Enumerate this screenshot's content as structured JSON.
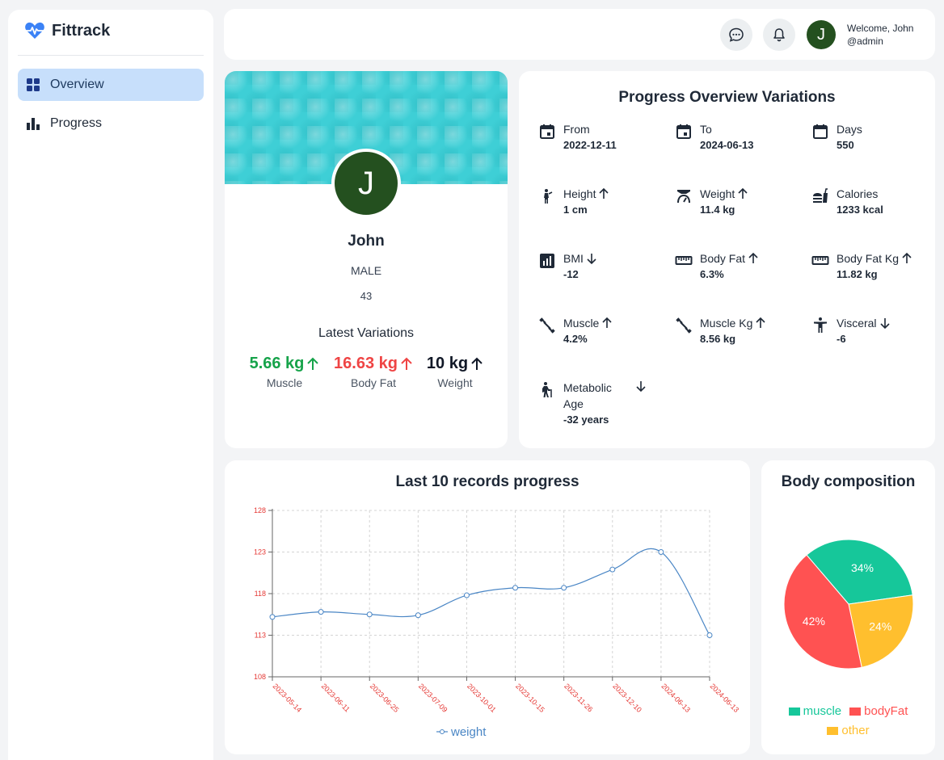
{
  "brand": {
    "name": "Fittrack",
    "accent": "#3b82f6"
  },
  "sidebar": {
    "items": [
      {
        "label": "Overview",
        "icon": "dashboard-icon",
        "active": true
      },
      {
        "label": "Progress",
        "icon": "bar-chart-icon",
        "active": false
      }
    ]
  },
  "header": {
    "avatar_initial": "J",
    "welcome": "Welcome, John",
    "handle": "@admin"
  },
  "profile": {
    "initial": "J",
    "name": "John",
    "gender": "MALE",
    "age": "43",
    "latest_title": "Latest Variations",
    "variations": [
      {
        "value": "5.66 kg",
        "label": "Muscle",
        "color": "#16a34a",
        "direction": "up"
      },
      {
        "value": "16.63 kg",
        "label": "Body Fat",
        "color": "#ef4444",
        "direction": "up"
      },
      {
        "value": "10 kg",
        "label": "Weight",
        "color": "#111827",
        "direction": "up"
      }
    ]
  },
  "overview": {
    "title": "Progress Overview Variations",
    "items": [
      {
        "label": "From",
        "value": "2022-12-11",
        "icon": "calendar-icon",
        "direction": ""
      },
      {
        "label": "To",
        "value": "2024-06-13",
        "icon": "calendar-icon",
        "direction": ""
      },
      {
        "label": "Days",
        "value": "550",
        "icon": "calendar-blank-icon",
        "direction": ""
      },
      {
        "label": "Height",
        "value": "1 cm",
        "icon": "person-height-icon",
        "direction": "up"
      },
      {
        "label": "Weight",
        "value": "11.4 kg",
        "icon": "weight-scale-icon",
        "direction": "up"
      },
      {
        "label": "Calories",
        "value": "1233 kcal",
        "icon": "fastfood-icon",
        "direction": ""
      },
      {
        "label": "BMI",
        "value": "-12",
        "icon": "bmi-chart-icon",
        "direction": "down"
      },
      {
        "label": "Body Fat",
        "value": "6.3%",
        "icon": "ruler-icon",
        "direction": "up"
      },
      {
        "label": "Body Fat Kg",
        "value": "11.82 kg",
        "icon": "ruler-icon",
        "direction": "up"
      },
      {
        "label": "Muscle",
        "value": "4.2%",
        "icon": "dumbbell-icon",
        "direction": "up"
      },
      {
        "label": "Muscle Kg",
        "value": "8.56 kg",
        "icon": "dumbbell-icon",
        "direction": "up"
      },
      {
        "label": "Visceral",
        "value": "-6",
        "icon": "accessibility-icon",
        "direction": "down"
      },
      {
        "label_lines": [
          "Metabolic",
          "Age"
        ],
        "value": "-32 years",
        "icon": "elderly-icon",
        "direction": "down"
      }
    ]
  },
  "chart": {
    "title": "Last 10 records progress",
    "chart_data": {
      "type": "line",
      "x": [
        "2023-05-14",
        "2023-06-11",
        "2023-06-25",
        "2023-07-09",
        "2023-10-01",
        "2023-10-15",
        "2023-11-26",
        "2023-12-10",
        "2024-06-13",
        "2024-06-13"
      ],
      "series": [
        {
          "name": "weight",
          "values": [
            115.2,
            115.8,
            115.5,
            115.4,
            117.8,
            118.7,
            118.7,
            120.9,
            123.0,
            113.0
          ]
        }
      ],
      "yticks": [
        108,
        113,
        118,
        123,
        128
      ],
      "ylim": [
        108,
        128
      ],
      "grid": true,
      "legend": "bottom",
      "line_color": "#4a86c5",
      "tick_color": "#e53935"
    }
  },
  "pie": {
    "title": "Body composition",
    "chart_data": {
      "type": "pie",
      "slices": [
        {
          "name": "muscle",
          "value": 34,
          "label": "34%",
          "color": "#16c79a"
        },
        {
          "name": "bodyFat",
          "value": 42,
          "label": "42%",
          "color": "#ff5252"
        },
        {
          "name": "other",
          "value": 24,
          "label": "24%",
          "color": "#ffbf2e"
        }
      ],
      "legend": "bottom"
    }
  }
}
